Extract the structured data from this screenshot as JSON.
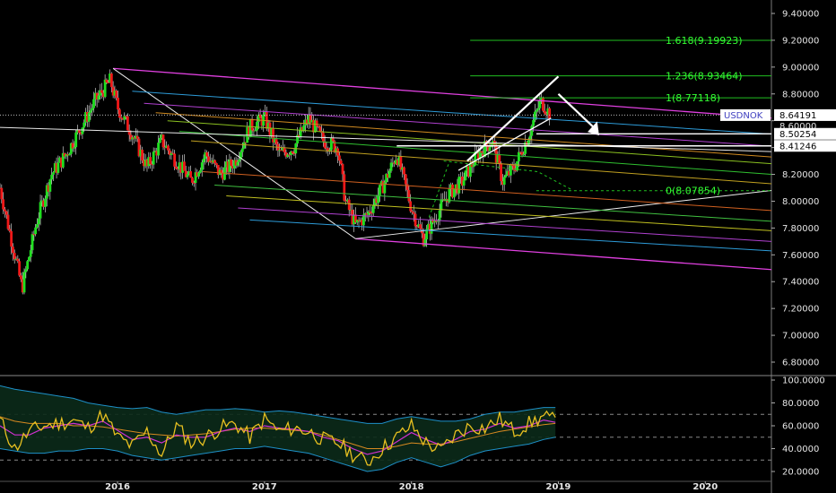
{
  "chart_data": {
    "type": "candlestick",
    "symbol_label": "USDNOK",
    "symbol_value": "8.64191",
    "hidden_label": "8.60000",
    "price_axis": {
      "ylim": [
        6.6,
        9.5
      ],
      "ticks": [
        "9.40000",
        "9.20000",
        "9.00000",
        "8.80000",
        "8.60000",
        "8.40000",
        "8.20000",
        "8.00000",
        "7.80000",
        "7.60000",
        "7.40000",
        "7.20000",
        "7.00000",
        "6.80000"
      ],
      "level_tags": [
        "8.50254",
        "8.41246"
      ]
    },
    "x_axis": {
      "labels": [
        "2016",
        "2017",
        "2018",
        "2019",
        "2020"
      ],
      "range": [
        2015.2,
        2020.45
      ]
    },
    "fibonacci_levels": [
      {
        "label": "1.618(9.19923)",
        "value": 9.19923
      },
      {
        "label": "1.236(8.93464)",
        "value": 8.93464
      },
      {
        "label": "1(8.77118)",
        "value": 8.77118
      },
      {
        "label": "0(8.07854)",
        "value": 8.07854
      }
    ],
    "price_series_keypoints": {
      "x": [
        2015.2,
        2015.35,
        2015.45,
        2015.55,
        2015.65,
        2015.75,
        2015.85,
        2015.95,
        2016.0,
        2016.1,
        2016.2,
        2016.3,
        2016.4,
        2016.5,
        2016.6,
        2016.7,
        2016.8,
        2016.9,
        2017.0,
        2017.1,
        2017.2,
        2017.3,
        2017.4,
        2017.5,
        2017.55,
        2017.62,
        2017.7,
        2017.8,
        2017.9,
        2018.0,
        2018.08,
        2018.15,
        2018.25,
        2018.35,
        2018.45,
        2018.55,
        2018.62,
        2018.7,
        2018.8,
        2018.88,
        2018.95
      ],
      "y": [
        8.1,
        7.35,
        7.85,
        8.2,
        8.35,
        8.55,
        8.75,
        8.9,
        8.7,
        8.5,
        8.25,
        8.45,
        8.3,
        8.15,
        8.35,
        8.2,
        8.3,
        8.55,
        8.62,
        8.35,
        8.4,
        8.62,
        8.45,
        8.4,
        8.0,
        7.82,
        7.9,
        8.1,
        8.35,
        7.95,
        7.72,
        7.85,
        8.05,
        8.15,
        8.35,
        8.45,
        8.15,
        8.25,
        8.5,
        8.75,
        8.64
      ]
    },
    "oscillator": {
      "ylim": [
        10,
        100
      ],
      "ticks": [
        "100.0000",
        "80.0000",
        "60.0000",
        "40.0000",
        "20.0000"
      ],
      "dashed_levels": [
        70,
        50,
        30
      ],
      "x": [
        2015.2,
        2015.3,
        2015.4,
        2015.5,
        2015.6,
        2015.7,
        2015.8,
        2015.9,
        2016.0,
        2016.1,
        2016.2,
        2016.3,
        2016.4,
        2016.5,
        2016.6,
        2016.7,
        2016.8,
        2016.9,
        2017.0,
        2017.1,
        2017.2,
        2017.3,
        2017.4,
        2017.5,
        2017.6,
        2017.7,
        2017.8,
        2017.9,
        2018.0,
        2018.1,
        2018.2,
        2018.3,
        2018.4,
        2018.5,
        2018.6,
        2018.7,
        2018.8,
        2018.9,
        2018.98
      ],
      "rsi": [
        65,
        40,
        55,
        60,
        62,
        65,
        58,
        70,
        50,
        42,
        55,
        35,
        60,
        45,
        50,
        58,
        62,
        50,
        66,
        55,
        58,
        55,
        48,
        45,
        35,
        28,
        40,
        50,
        60,
        45,
        38,
        52,
        60,
        58,
        66,
        55,
        62,
        68,
        64
      ],
      "signal": [
        60,
        52,
        52,
        58,
        60,
        62,
        60,
        64,
        56,
        48,
        50,
        45,
        52,
        50,
        50,
        55,
        58,
        55,
        60,
        58,
        57,
        55,
        50,
        47,
        40,
        35,
        38,
        46,
        54,
        48,
        43,
        48,
        55,
        57,
        62,
        58,
        60,
        65,
        63
      ],
      "upper_band": [
        95,
        92,
        90,
        88,
        86,
        84,
        80,
        78,
        76,
        75,
        76,
        72,
        70,
        72,
        74,
        74,
        75,
        74,
        72,
        73,
        72,
        70,
        68,
        66,
        64,
        62,
        62,
        66,
        68,
        66,
        64,
        64,
        66,
        70,
        72,
        72,
        74,
        76,
        76
      ],
      "lower_band": [
        40,
        38,
        36,
        36,
        38,
        38,
        40,
        40,
        38,
        34,
        32,
        30,
        32,
        34,
        36,
        38,
        40,
        40,
        42,
        40,
        38,
        36,
        32,
        28,
        24,
        20,
        22,
        28,
        32,
        28,
        24,
        28,
        34,
        38,
        40,
        42,
        44,
        48,
        50
      ],
      "middle": [
        68,
        64,
        62,
        62,
        62,
        60,
        60,
        59,
        57,
        55,
        53,
        52,
        51,
        52,
        53,
        55,
        57,
        58,
        58,
        57,
        56,
        55,
        52,
        48,
        44,
        40,
        40,
        42,
        45,
        44,
        44,
        46,
        49,
        52,
        55,
        57,
        59,
        61,
        62
      ]
    }
  }
}
